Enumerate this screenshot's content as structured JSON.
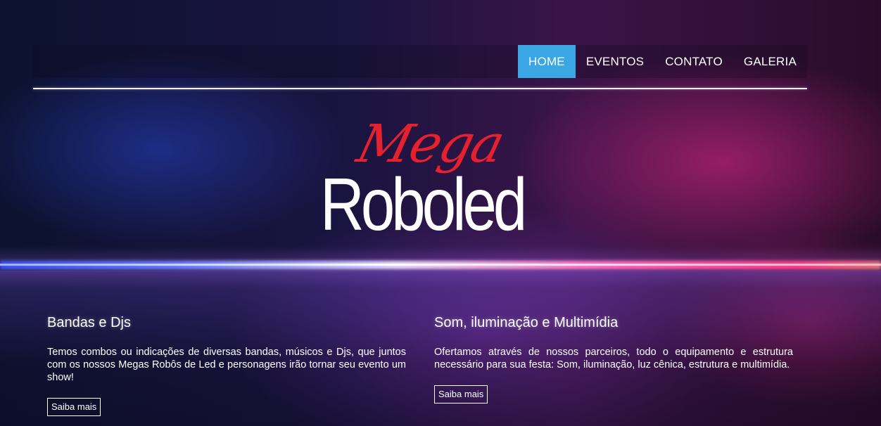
{
  "nav": {
    "items": [
      {
        "label": "HOME",
        "active": true
      },
      {
        "label": "EVENTOS",
        "active": false
      },
      {
        "label": "CONTATO",
        "active": false
      },
      {
        "label": "GALERIA",
        "active": false
      }
    ],
    "active_color": "#3aa7e4"
  },
  "logo": {
    "script_text": "Mega",
    "main_text": "Roboled",
    "script_color": "#e4212c",
    "main_color": "#ffffff"
  },
  "sections": [
    {
      "title": "Bandas e Djs",
      "text": "Temos combos ou indicações de diversas bandas, músicos e Djs, que juntos com os nossos Megas Robôs de Led e personagens irão tornar seu evento um show!",
      "button": "Saiba mais"
    },
    {
      "title": "Som, iluminação e Multimídia",
      "text": "Ofertamos através de nossos parceiros, todo o equipamento e estrutura necessário para sua festa: Som, iluminação, luz cênica, estrutura e multimídia.",
      "button": "Saiba mais"
    }
  ]
}
